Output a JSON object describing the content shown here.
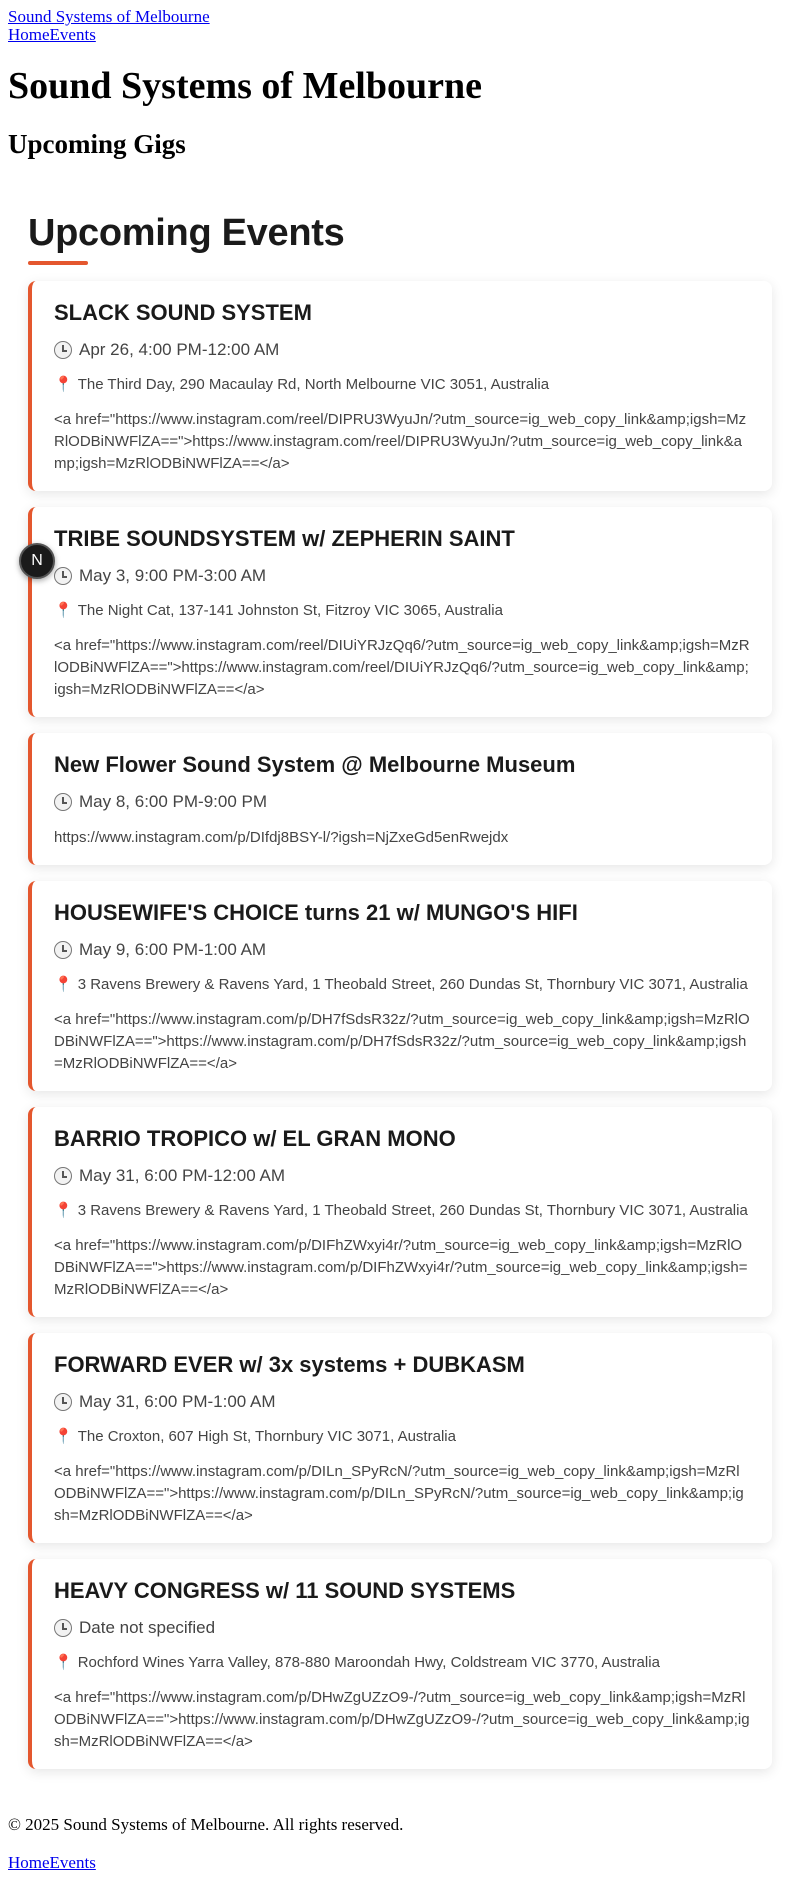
{
  "header": {
    "site_link": "Sound Systems of Melbourne",
    "nav": [
      "Home",
      "Events"
    ],
    "title": "Sound Systems of Melbourne",
    "subtitle": "Upcoming Gigs"
  },
  "main": {
    "section_title": "Upcoming Events",
    "events": [
      {
        "title": "SLACK SOUND SYSTEM",
        "date": "Apr 26, 4:00 PM-12:00 AM",
        "location": "The Third Day, 290 Macaulay Rd, North Melbourne VIC 3051, Australia",
        "description": "<a href=\"https://www.instagram.com/reel/DIPRU3WyuJn/?utm_source=ig_web_copy_link&amp;igsh=MzRlODBiNWFlZA==\">https://www.instagram.com/reel/DIPRU3WyuJn/?utm_source=ig_web_copy_link&amp;igsh=MzRlODBiNWFlZA==</a>"
      },
      {
        "title": "TRIBE SOUNDSYSTEM w/ ZEPHERIN SAINT",
        "date": "May 3, 9:00 PM-3:00 AM",
        "location": "The Night Cat, 137-141 Johnston St, Fitzroy VIC 3065, Australia",
        "description": "<a href=\"https://www.instagram.com/reel/DIUiYRJzQq6/?utm_source=ig_web_copy_link&amp;igsh=MzRlODBiNWFlZA==\">https://www.instagram.com/reel/DIUiYRJzQq6/?utm_source=ig_web_copy_link&amp;igsh=MzRlODBiNWFlZA==</a>"
      },
      {
        "title": "New Flower Sound System @ Melbourne Museum",
        "date": "May 8, 6:00 PM-9:00 PM",
        "location": "",
        "description": "https://www.instagram.com/p/DIfdj8BSY-l/?igsh=NjZxeGd5enRwejdx"
      },
      {
        "title": "HOUSEWIFE'S CHOICE turns 21 w/ MUNGO'S HIFI",
        "date": "May 9, 6:00 PM-1:00 AM",
        "location": "3 Ravens Brewery & Ravens Yard, 1 Theobald Street, 260 Dundas St, Thornbury VIC 3071, Australia",
        "description": "<a href=\"https://www.instagram.com/p/DH7fSdsR32z/?utm_source=ig_web_copy_link&amp;igsh=MzRlODBiNWFlZA==\">https://www.instagram.com/p/DH7fSdsR32z/?utm_source=ig_web_copy_link&amp;igsh=MzRlODBiNWFlZA==</a>"
      },
      {
        "title": "BARRIO TROPICO w/ EL GRAN MONO",
        "date": "May 31, 6:00 PM-12:00 AM",
        "location": "3 Ravens Brewery & Ravens Yard, 1 Theobald Street, 260 Dundas St, Thornbury VIC 3071, Australia",
        "description": "<a href=\"https://www.instagram.com/p/DIFhZWxyi4r/?utm_source=ig_web_copy_link&amp;igsh=MzRlODBiNWFlZA==\">https://www.instagram.com/p/DIFhZWxyi4r/?utm_source=ig_web_copy_link&amp;igsh=MzRlODBiNWFlZA==</a>"
      },
      {
        "title": "FORWARD EVER w/ 3x systems + DUBKASM",
        "date": "May 31, 6:00 PM-1:00 AM",
        "location": "The Croxton, 607 High St, Thornbury VIC 3071, Australia",
        "description": "<a href=\"https://www.instagram.com/p/DILn_SPyRcN/?utm_source=ig_web_copy_link&amp;igsh=MzRlODBiNWFlZA==\">https://www.instagram.com/p/DILn_SPyRcN/?utm_source=ig_web_copy_link&amp;igsh=MzRlODBiNWFlZA==</a>"
      },
      {
        "title": "HEAVY CONGRESS w/ 11 SOUND SYSTEMS",
        "date": "Date not specified",
        "location": "Rochford Wines Yarra Valley, 878-880 Maroondah Hwy, Coldstream VIC 3770, Australia",
        "description": "<a href=\"https://www.instagram.com/p/DHwZgUZzO9-/?utm_source=ig_web_copy_link&amp;igsh=MzRlODBiNWFlZA==\">https://www.instagram.com/p/DHwZgUZzO9-/?utm_source=ig_web_copy_link&amp;igsh=MzRlODBiNWFlZA==</a>"
      }
    ]
  },
  "badge": {
    "letter": "N"
  },
  "footer": {
    "copyright": "© 2025 Sound Systems of Melbourne. All rights reserved.",
    "nav": [
      "Home",
      "Events"
    ]
  },
  "colors": {
    "accent": "#e4572e",
    "link": "#0000ee",
    "text": "#1a1a1a"
  }
}
